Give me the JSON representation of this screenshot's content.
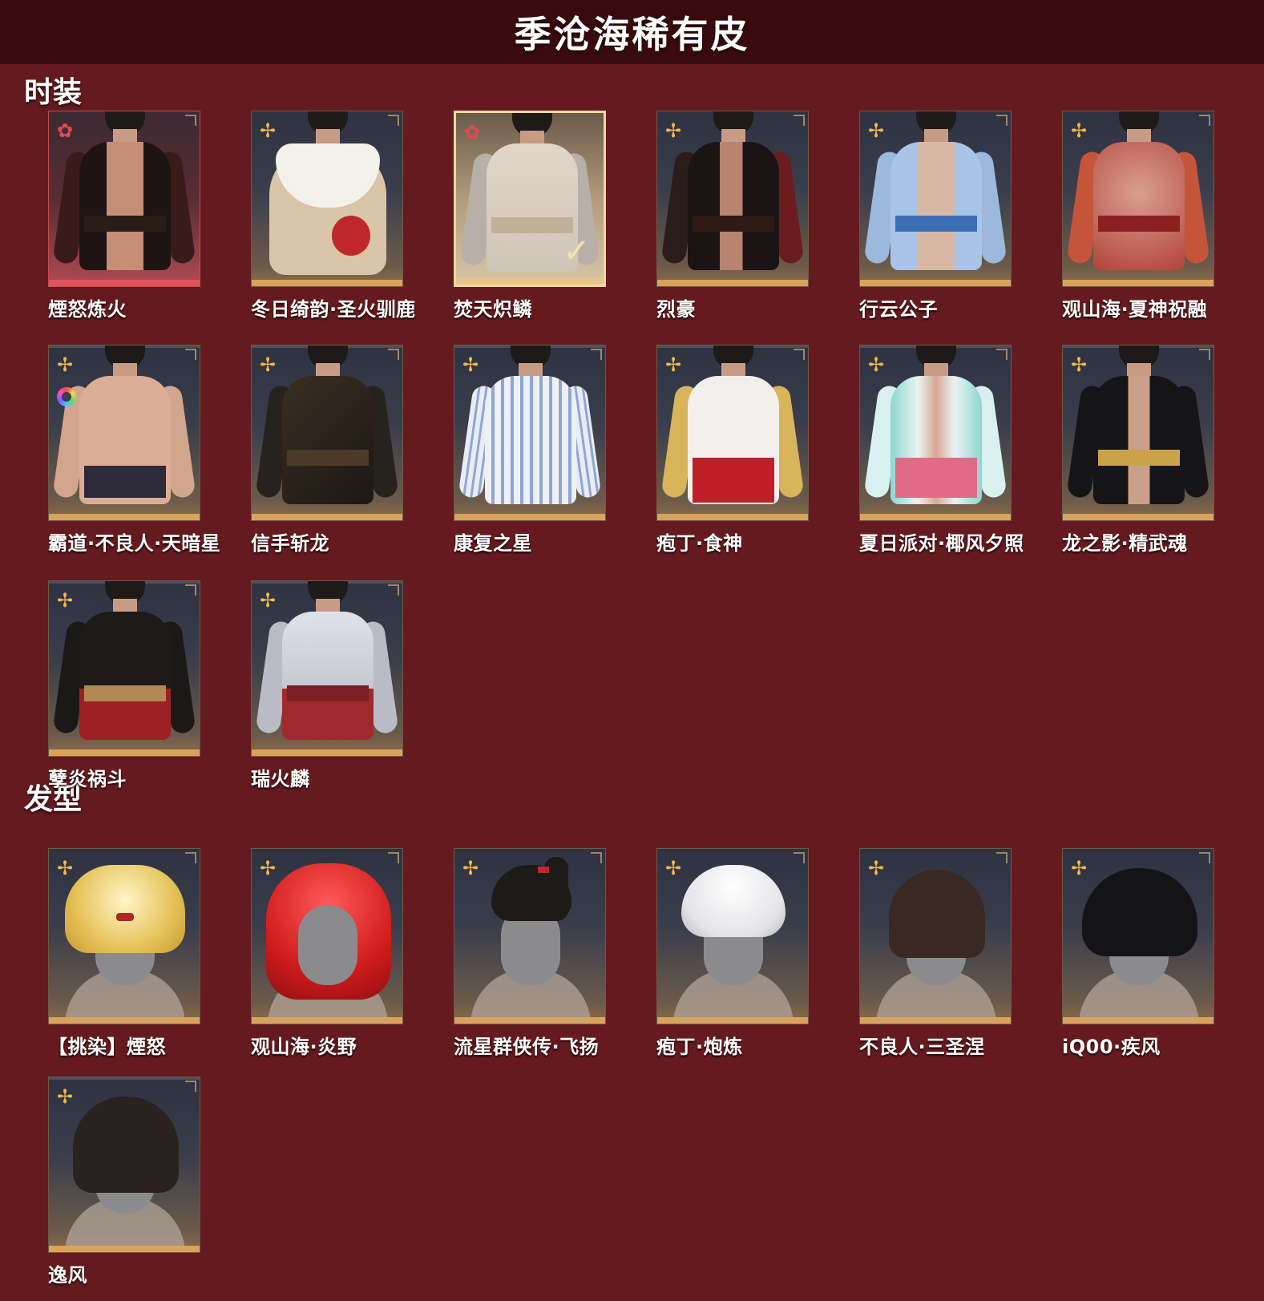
{
  "title": "季沧海稀有皮",
  "sections": {
    "outfits": {
      "title": "时装",
      "items": [
        {
          "name": "煙怒炼火",
          "rarity_icon": "red-flower-icon"
        },
        {
          "name": "冬日绮韵·圣火驯鹿",
          "rarity_icon": "gold-flower-icon"
        },
        {
          "name": "焚天炽鳞",
          "rarity_icon": "red-flower-icon",
          "selected": true
        },
        {
          "name": "烈豪",
          "rarity_icon": "gold-flower-icon"
        },
        {
          "name": "行云公子",
          "rarity_icon": "gold-flower-icon"
        },
        {
          "name": "观山海·夏神祝融",
          "rarity_icon": "gold-flower-icon"
        },
        {
          "name": "霸道·不良人·天暗星",
          "rarity_icon": "gold-flower-icon"
        },
        {
          "name": "信手斩龙",
          "rarity_icon": "gold-flower-icon"
        },
        {
          "name": "康复之星",
          "rarity_icon": "gold-flower-icon"
        },
        {
          "name": "疱丁·食神",
          "rarity_icon": "gold-flower-icon"
        },
        {
          "name": "夏日派对·椰风夕照",
          "rarity_icon": "gold-flower-icon"
        },
        {
          "name": "龙之影·精武魂",
          "rarity_icon": "gold-flower-icon"
        },
        {
          "name": "孽炎祸斗",
          "rarity_icon": "gold-flower-icon"
        },
        {
          "name": "瑞火麟",
          "rarity_icon": "gold-flower-icon"
        }
      ]
    },
    "hairstyles": {
      "title": "发型",
      "items": [
        {
          "name": "【挑染】煙怒",
          "rarity_icon": "gold-flower-icon"
        },
        {
          "name": "观山海·炎野",
          "rarity_icon": "gold-flower-icon"
        },
        {
          "name": "流星群侠传·飞扬",
          "rarity_icon": "gold-flower-icon"
        },
        {
          "name": "疱丁·炮炼",
          "rarity_icon": "gold-flower-icon"
        },
        {
          "name": "不良人·三圣涅",
          "rarity_icon": "gold-flower-icon"
        },
        {
          "name": "iQ00·疾风",
          "rarity_icon": "gold-flower-icon"
        },
        {
          "name": "逸风",
          "rarity_icon": "gold-flower-icon"
        }
      ]
    }
  },
  "colors": {
    "background": "#651a1f",
    "title_bar": "#3a0b0e",
    "gold_accent": "#d9a35e",
    "red_accent": "#e0545a"
  }
}
